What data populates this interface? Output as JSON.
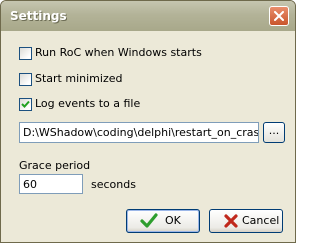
{
  "window": {
    "title": "Settings"
  },
  "options": [
    {
      "label": "Run RoC when Windows starts",
      "checked": false
    },
    {
      "label": "Start minimized",
      "checked": false
    },
    {
      "label": "Log events to a file",
      "checked": true
    }
  ],
  "log_file": {
    "value": "D:\\WShadow\\coding\\delphi\\restart_on_crash\\log",
    "browse_label": "..."
  },
  "grace": {
    "label": "Grace period",
    "value": "60",
    "unit": "seconds"
  },
  "buttons": {
    "ok": "OK",
    "cancel": "Cancel"
  },
  "icons": {
    "close": "close-icon",
    "ok": "checkmark-icon",
    "cancel": "x-icon"
  },
  "colors": {
    "ok_icon": "#2e9e2e",
    "cancel_icon": "#c0281c"
  }
}
